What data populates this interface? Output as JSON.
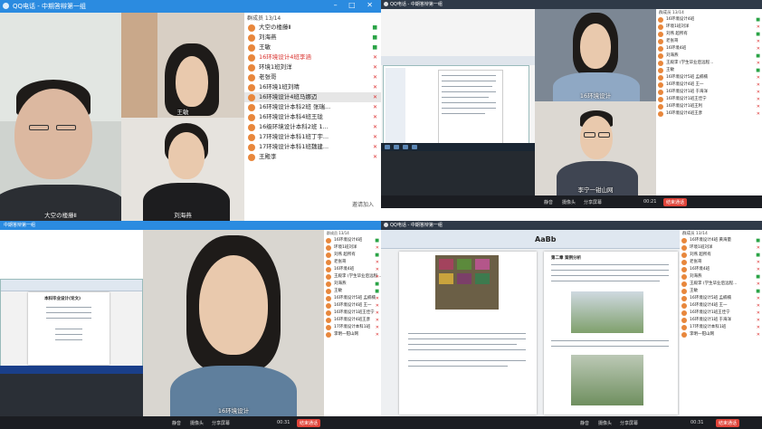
{
  "q1": {
    "window_title": "QQ电话 - 中期答辩第一组",
    "member_count": "群成员 13/14",
    "members": [
      {
        "name": "大空の楼藤Ⅱ",
        "status": "on"
      },
      {
        "name": "刘海燕",
        "status": "on"
      },
      {
        "name": "王敏",
        "status": "on"
      },
      {
        "name": "16环境设计4班李涵",
        "status": "off"
      },
      {
        "name": "环境1班刘洋",
        "status": "off"
      },
      {
        "name": "老张哥",
        "status": "off"
      },
      {
        "name": "16环境1班刘晴",
        "status": "off"
      },
      {
        "name": "16环境设计4班马娜迈",
        "status": "off"
      },
      {
        "name": "16环境设计本科2班 张瑞...",
        "status": "off"
      },
      {
        "name": "16环境设计本科4班王珑",
        "status": "off"
      },
      {
        "name": "16级环境设计本科2班 1...",
        "status": "off"
      },
      {
        "name": "17环境设计本科1班丁宇...",
        "status": "off"
      },
      {
        "name": "17环境设计本科1班魏建...",
        "status": "off"
      },
      {
        "name": "王殿李",
        "status": "off"
      }
    ],
    "invite_label": "邀请加入",
    "tiles": {
      "main_label": "大空の楼藤Ⅱ",
      "top_right_label": "王敏",
      "bottom_right_label": "刘海燕"
    },
    "status_on_glyph": "■",
    "status_off_glyph": "✕"
  },
  "q2": {
    "window_title": "QQ电话 - 中期答辩第一组",
    "member_count": "群成员 13/14",
    "members": [
      {
        "name": "16环境设计4班",
        "status": "on"
      },
      {
        "name": "环境1班刘洋",
        "status": "off"
      },
      {
        "name": "刘燕 超所有",
        "status": "on"
      },
      {
        "name": "老张哥",
        "status": "off"
      },
      {
        "name": "16环境4班",
        "status": "off"
      },
      {
        "name": "刘海燕",
        "status": "on"
      },
      {
        "name": "王殿李 (学生毕业后远程...",
        "status": "off"
      },
      {
        "name": "王敏",
        "status": "on"
      },
      {
        "name": "16环境设计5班 孟楠楠",
        "status": "off"
      },
      {
        "name": "16环境设计4班 王一",
        "status": "off"
      },
      {
        "name": "16环境设计1班 于海洋",
        "status": "off"
      },
      {
        "name": "16环境设计1班王佳宁",
        "status": "off"
      },
      {
        "name": "16环境设计1班王利",
        "status": "off"
      },
      {
        "name": "16环境设计4班王彦",
        "status": "off"
      }
    ],
    "top_tile_label": "16环境设计",
    "bottom_tile_label": "李宁一钳山网",
    "toolbar": {
      "mute": "静音",
      "camera": "摄像头",
      "share": "分享屏幕",
      "time": "00:21",
      "end": "结束通话"
    }
  },
  "q3": {
    "window_title": "中期答辩第一组",
    "member_count": "群成员 13/14",
    "members": [
      {
        "name": "16环境设计4班",
        "status": "on"
      },
      {
        "name": "环境1班刘洋",
        "status": "off"
      },
      {
        "name": "刘燕 超所有",
        "status": "on"
      },
      {
        "name": "老张哥",
        "status": "off"
      },
      {
        "name": "16环境4班",
        "status": "off"
      },
      {
        "name": "王殿李 (学生毕业后远程...",
        "status": "off"
      },
      {
        "name": "刘海燕",
        "status": "on"
      },
      {
        "name": "王敏",
        "status": "on"
      },
      {
        "name": "16环境设计5班 孟楠楠",
        "status": "off"
      },
      {
        "name": "16环境设计4班 王一",
        "status": "off"
      },
      {
        "name": "16环境设计1班王佳宁",
        "status": "off"
      },
      {
        "name": "16环境设计4班王彦",
        "status": "off"
      },
      {
        "name": "17环境设计本科1班",
        "status": "off"
      },
      {
        "name": "李明一钳山网",
        "status": "off"
      }
    ],
    "tile_label": "16环境设计",
    "toolbar": {
      "mute": "静音",
      "camera": "摄像头",
      "share": "分享屏幕",
      "time": "00:31",
      "end": "结束通话"
    },
    "doc_heading": "本科毕业设计(论文)"
  },
  "q4": {
    "window_title": "QQ电话 - 中期答辩第一组",
    "member_count": "群成员 13/14",
    "members": [
      {
        "name": "16环境设计4班 黄海量",
        "status": "on"
      },
      {
        "name": "环境1班刘洋",
        "status": "off"
      },
      {
        "name": "刘燕 超所有",
        "status": "on"
      },
      {
        "name": "老张哥",
        "status": "off"
      },
      {
        "name": "16环境4班",
        "status": "off"
      },
      {
        "name": "刘海燕",
        "status": "on"
      },
      {
        "name": "王殿李 (学生毕业后远程...",
        "status": "off"
      },
      {
        "name": "王敏",
        "status": "on"
      },
      {
        "name": "16环境设计5班 孟楠楠",
        "status": "off"
      },
      {
        "name": "16环境设计4班 王一",
        "status": "off"
      },
      {
        "name": "16环境设计1班王佳宁",
        "status": "off"
      },
      {
        "name": "16环境设计1班 于海洋",
        "status": "off"
      },
      {
        "name": "17环境设计本科1班",
        "status": "off"
      },
      {
        "name": "李明一钳山网",
        "status": "off"
      }
    ],
    "toolbar": {
      "mute": "静音",
      "camera": "摄像头",
      "share": "分享屏幕",
      "time": "00:31",
      "end": "结束通话"
    },
    "doc_heading": "第二章 案例分析",
    "style_sample": "AaBb"
  }
}
